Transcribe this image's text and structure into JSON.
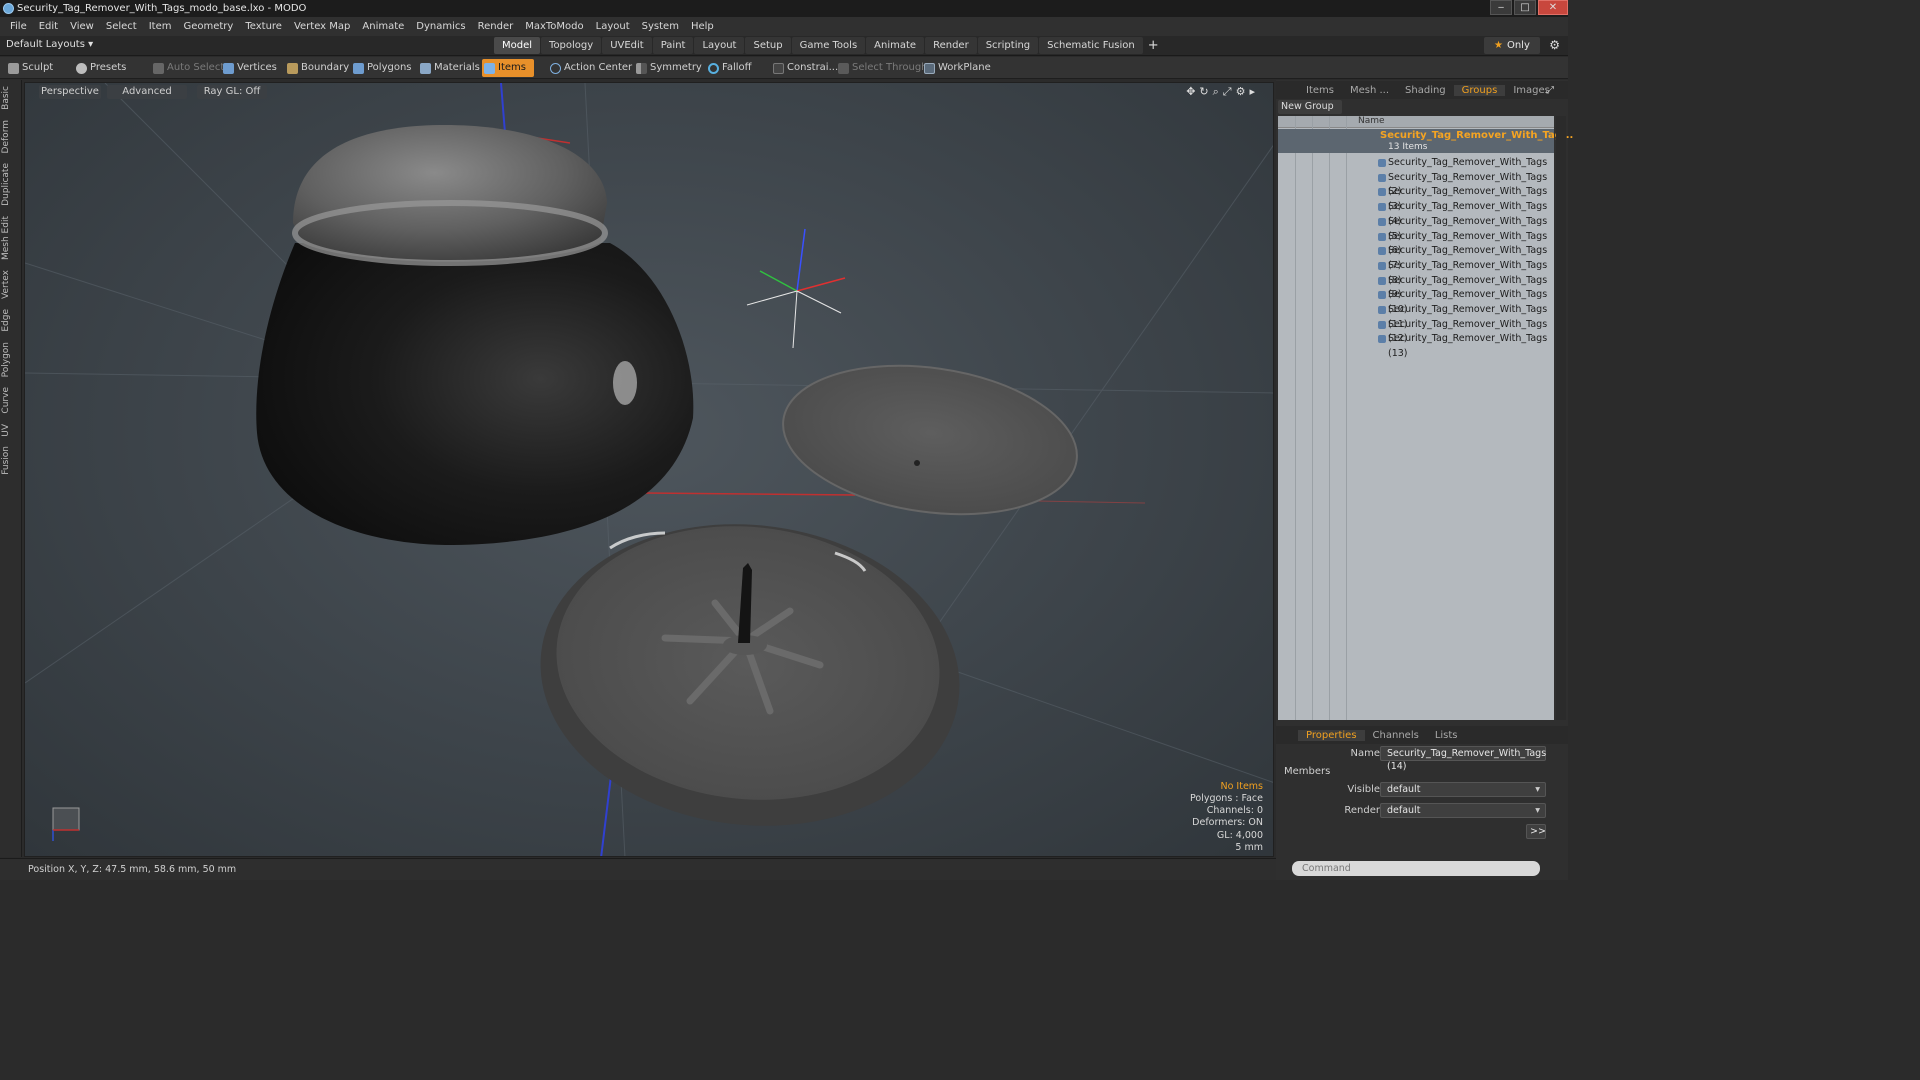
{
  "window": {
    "title": "Security_Tag_Remover_With_Tags_modo_base.lxo - MODO",
    "controls": [
      "‒",
      "□",
      "✕"
    ]
  },
  "menu": [
    "File",
    "Edit",
    "View",
    "Select",
    "Item",
    "Geometry",
    "Texture",
    "Vertex Map",
    "Animate",
    "Dynamics",
    "Render",
    "MaxToModo",
    "Layout",
    "System",
    "Help"
  ],
  "layout_bar": {
    "layouts_label": "Default Layouts ▾",
    "tabs": [
      "Model",
      "Topology",
      "UVEdit",
      "Paint",
      "Layout",
      "Setup",
      "Game Tools",
      "Animate",
      "Render",
      "Scripting",
      "Schematic Fusion"
    ],
    "active_tab": "Model",
    "add_tab": "+",
    "only_label": "Only",
    "star": "★",
    "gear": "⚙"
  },
  "toolbar": {
    "sculpt": "Sculpt",
    "presets": "Presets",
    "auto_select": "Auto Select",
    "vertices": "Vertices",
    "boundary": "Boundary",
    "polygons": "Polygons",
    "materials": "Materials",
    "items": "Items",
    "action_center": "Action Center",
    "symmetry": "Symmetry",
    "falloff": "Falloff",
    "constraints": "Constrai...",
    "select_through": "Select Through",
    "workplane": "WorkPlane"
  },
  "left_tabs": [
    "Basic",
    "Deform",
    "Duplicate",
    "Mesh Edit",
    "Vertex",
    "Edge",
    "Polygon",
    "Curve",
    "UV",
    "Fusion"
  ],
  "viewport": {
    "view_mode": "Perspective",
    "shading": "Advanced",
    "raygl": "Ray GL: Off",
    "icons": "✥↻⌕⤢⚙▸",
    "info": {
      "no_items": "No Items",
      "polygons": "Polygons : Face",
      "channels": "Channels: 0",
      "deformers": "Deformers: ON",
      "gl": "GL: 4,000",
      "scale": "5 mm"
    }
  },
  "status": {
    "position": "Position X, Y, Z:   47.5 mm, 58.6 mm, 50 mm"
  },
  "right_panel": {
    "top_tabs": [
      "Items",
      "Mesh ...",
      "Shading",
      "Groups",
      "Images"
    ],
    "active_top_tab": "Groups",
    "new_group": "New Group",
    "list_header": "Name",
    "group": {
      "name": "Security_Tag_Remover_With_Tag...",
      "count": "13 Items"
    },
    "items": [
      "Security_Tag_Remover_With_Tags",
      "Security_Tag_Remover_With_Tags (2)",
      "Security_Tag_Remover_With_Tags (3)",
      "Security_Tag_Remover_With_Tags (4)",
      "Security_Tag_Remover_With_Tags (5)",
      "Security_Tag_Remover_With_Tags (6)",
      "Security_Tag_Remover_With_Tags (7)",
      "Security_Tag_Remover_With_Tags (8)",
      "Security_Tag_Remover_With_Tags (9)",
      "Security_Tag_Remover_With_Tags (10)",
      "Security_Tag_Remover_With_Tags (11)",
      "Security_Tag_Remover_With_Tags (12)",
      "Security_Tag_Remover_With_Tags (13)"
    ],
    "bottom_tabs": [
      "Properties",
      "Channels",
      "Lists"
    ],
    "active_bottom_tab": "Properties",
    "properties": {
      "name_label": "Name",
      "name_value": "Security_Tag_Remover_With_Tags (14)",
      "members_label": "Members",
      "visible_label": "Visible",
      "visible_value": "default",
      "render_label": "Render",
      "render_value": "default",
      "more": ">>"
    },
    "command_placeholder": "Command"
  },
  "colors": {
    "accent": "#f0a020",
    "viewport_bg": "#454c52",
    "list_bg": "#b4b9be"
  }
}
